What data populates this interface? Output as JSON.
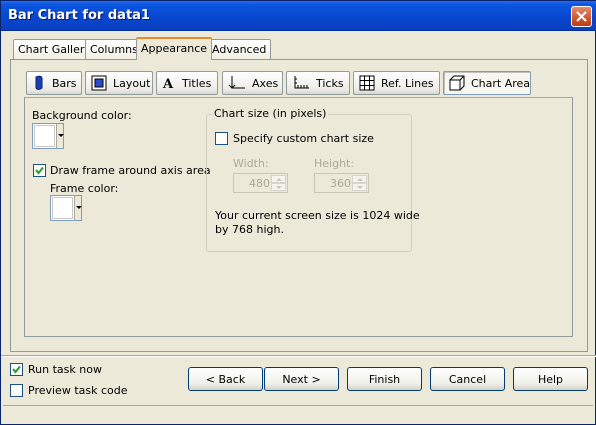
{
  "window": {
    "title": "Bar Chart for data1"
  },
  "top_tabs": [
    {
      "label": "Chart Gallery"
    },
    {
      "label": "Columns"
    },
    {
      "label": "Appearance",
      "active": true
    },
    {
      "label": "Advanced"
    }
  ],
  "sub_tabs": [
    {
      "label": "Bars",
      "icon": "bars-icon"
    },
    {
      "label": "Layout",
      "icon": "layout-icon"
    },
    {
      "label": "Titles",
      "icon": "titles-icon"
    },
    {
      "label": "Axes",
      "icon": "axes-icon"
    },
    {
      "label": "Ticks",
      "icon": "ticks-icon"
    },
    {
      "label": "Ref. Lines",
      "icon": "grid-icon"
    },
    {
      "label": "Chart Area",
      "icon": "chart-area-icon",
      "active": true
    }
  ],
  "chart_area": {
    "background_color_label": "Background color:",
    "background_color": "#ffffff",
    "draw_frame_label": "Draw frame around axis area",
    "draw_frame_checked": true,
    "frame_color_label": "Frame color:",
    "frame_color": "#ffffff"
  },
  "chart_size": {
    "group_label": "Chart size  (in pixels)",
    "custom_label": "Specify custom chart size",
    "custom_checked": false,
    "width_label": "Width:",
    "width_value": "480",
    "height_label": "Height:",
    "height_value": "360",
    "screen_info_line1": "Your current screen size is 1024 wide",
    "screen_info_line2": "by 768 high."
  },
  "footer": {
    "run_task_label": "Run task now",
    "run_task_checked": true,
    "preview_label": "Preview task code",
    "preview_checked": false,
    "back_label": "< Back",
    "next_label": "Next >",
    "finish_label": "Finish",
    "cancel_label": "Cancel",
    "help_label": "Help"
  },
  "colors": {
    "titlebar": "#0847d0",
    "active_tab_accent": "#e68b2c",
    "dialog_face": "#ece9d8"
  }
}
